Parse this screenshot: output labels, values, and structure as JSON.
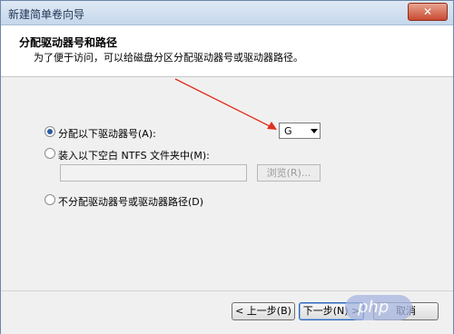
{
  "window": {
    "title": "新建简单卷向导",
    "close_symbol": "✕"
  },
  "header": {
    "title": "分配驱动器号和路径",
    "subtitle": "为了便于访问，可以给磁盘分区分配驱动器号或驱动器路径。"
  },
  "options": {
    "assign_letter": {
      "label": "分配以下驱动器号(A):",
      "checked": true
    },
    "mount_folder": {
      "label": "装入以下空白 NTFS 文件夹中(M):",
      "checked": false
    },
    "no_assign": {
      "label": "不分配驱动器号或驱动器路径(D)",
      "checked": false
    }
  },
  "drive_select": {
    "value": "G"
  },
  "browse_button": {
    "label": "浏览(R)..."
  },
  "footer": {
    "back_label": "< 上一步(B)",
    "next_label": "下一步(N) >",
    "cancel_label": "取消"
  },
  "watermark": {
    "text": "php"
  },
  "colors": {
    "arrow": "#e0301e",
    "accent": "#2b5aa3"
  }
}
